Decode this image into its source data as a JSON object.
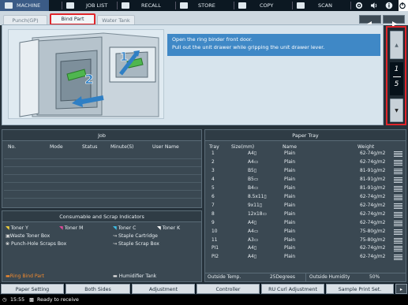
{
  "topbar": {
    "items": [
      {
        "label": "MACHINE",
        "icon": "machine-icon",
        "active": true
      },
      {
        "label": "JOB LIST",
        "icon": "job-list-icon"
      },
      {
        "label": "RECALL",
        "icon": "recall-icon"
      },
      {
        "label": "STORE",
        "icon": "store-icon"
      },
      {
        "label": "COPY",
        "icon": "copy-icon"
      },
      {
        "label": "SCAN",
        "icon": "scan-icon"
      }
    ]
  },
  "tabs": [
    {
      "label": "Punch(GP)"
    },
    {
      "label": "Bind Part"
    },
    {
      "label": "Water Tank"
    }
  ],
  "message": {
    "line1": "Open the ring binder front door.",
    "line2": "Pull out the unit drawer while gripping the unit drawer lever."
  },
  "illustration": {
    "step1": "1",
    "step2": "2"
  },
  "pager": {
    "current": "1",
    "total": "5",
    "up": "▲",
    "down": "▼"
  },
  "job": {
    "title": "Job",
    "columns": [
      "No.",
      "Mode",
      "Status",
      "Minute(S)",
      "User Name"
    ]
  },
  "consumables": {
    "title": "Consumable and Scrap Indicators",
    "items": [
      "Toner Y",
      "Toner M",
      "Toner C",
      "Toner K",
      "Waste Toner Box",
      "Staple Cartridge",
      "Punch-Hole Scraps Box",
      "Staple Scrap Box"
    ],
    "alert_left": "Ring Bind Part",
    "alert_right": "Humidifier Tank"
  },
  "paper_tray": {
    "title": "Paper Tray",
    "columns": [
      "Tray",
      "Size(mm)",
      "Name",
      "Weight"
    ],
    "rows": [
      [
        "1",
        "A4▯",
        "Plain",
        "62-74g/m2"
      ],
      [
        "2",
        "A4▭",
        "Plain",
        "62-74g/m2"
      ],
      [
        "3",
        "B5▯",
        "Plain",
        "81-91g/m2"
      ],
      [
        "4",
        "B5▭",
        "Plain",
        "81-91g/m2"
      ],
      [
        "5",
        "B4▭",
        "Plain",
        "81-91g/m2"
      ],
      [
        "6",
        "8.5x11▯",
        "Plain",
        "62-74g/m2"
      ],
      [
        "7",
        "9x11▯",
        "Plain",
        "62-74g/m2"
      ],
      [
        "8",
        "12x18▭",
        "Plain",
        "62-74g/m2"
      ],
      [
        "9",
        "A4▯",
        "Plain",
        "62-74g/m2"
      ],
      [
        "10",
        "A4▭",
        "Plain",
        "75-80g/m2"
      ],
      [
        "11",
        "A3▭",
        "Plain",
        "75-80g/m2"
      ],
      [
        "PI1",
        "A4▯",
        "Plain",
        "62-74g/m2"
      ],
      [
        "PI2",
        "A4▯",
        "Plain",
        "62-74g/m2"
      ]
    ],
    "outside_temp_label": "Outside Temp.",
    "outside_temp_value": "25Degrees",
    "outside_humidity_label": "Outside Humidity",
    "outside_humidity_value": "50%"
  },
  "bottom_nav": [
    "Paper Setting",
    "Both Sides",
    "Adjustment",
    "Controller",
    "RU Curl Adjustment",
    "Sample Print Set."
  ],
  "status": {
    "time": "15:55",
    "text": "Ready to receive"
  },
  "colors": {
    "accent_red": "#e0252a",
    "message_blue": "#3f88c6",
    "active_tab": "#3b5b86"
  }
}
